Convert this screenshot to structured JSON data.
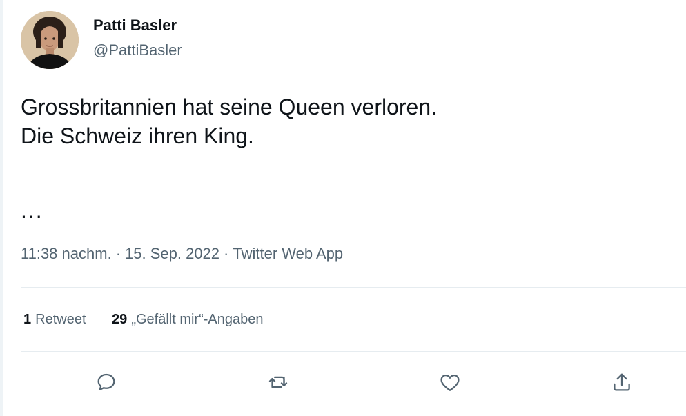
{
  "author": {
    "display_name": "Patti Basler",
    "handle": "@PattiBasler"
  },
  "tweet": {
    "lines": [
      "Grossbritannien hat seine Queen verloren.",
      "Die Schweiz ihren King."
    ],
    "ellipsis": "..."
  },
  "meta": {
    "time": "11:38 nachm.",
    "date": "15. Sep. 2022",
    "source": "Twitter Web App",
    "separator": "·"
  },
  "stats": {
    "retweets_count": "1",
    "retweets_label": "Retweet",
    "likes_count": "29",
    "likes_label": "„Gefällt mir“-Angaben"
  },
  "actions": {
    "reply_icon": "reply-icon",
    "retweet_icon": "retweet-icon",
    "like_icon": "like-icon",
    "share_icon": "share-icon"
  },
  "colors": {
    "text": "#0f1419",
    "secondary": "#536471",
    "divider": "#e6ecf0"
  }
}
